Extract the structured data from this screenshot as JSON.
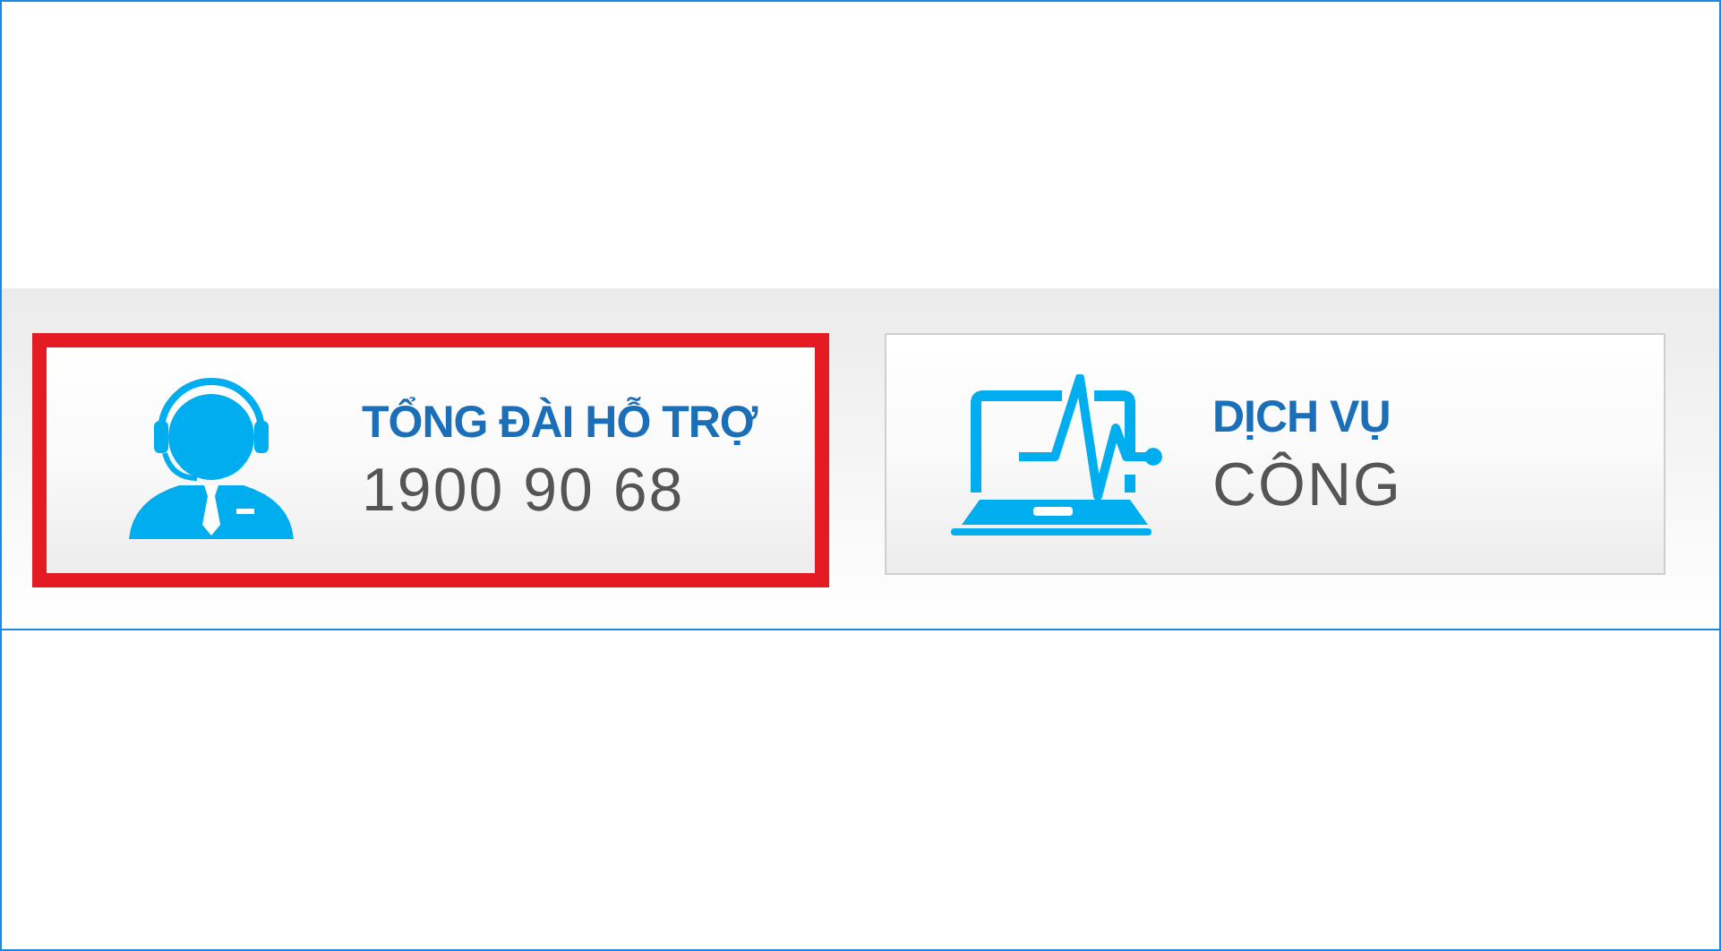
{
  "cards": [
    {
      "kind": "headset",
      "selected": true,
      "title": "TỔNG ĐÀI HỖ TRỢ",
      "subtitle": "1900 90 68"
    },
    {
      "kind": "laptop",
      "selected": false,
      "title": "DỊCH VỤ",
      "subtitle": "CÔNG"
    }
  ]
}
